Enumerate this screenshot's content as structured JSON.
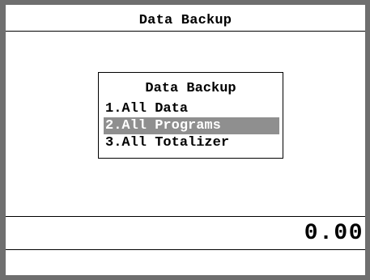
{
  "window": {
    "title": "Data Backup"
  },
  "dialog": {
    "title": "Data Backup",
    "items": [
      {
        "label": "1.All Data",
        "selected": false
      },
      {
        "label": "2.All Programs",
        "selected": true
      },
      {
        "label": "3.All Totalizer",
        "selected": false
      }
    ]
  },
  "footer": {
    "amount": "0.00"
  },
  "colors": {
    "selection": "#8f8f8f",
    "frame": "#6f6f6f",
    "text": "#000000",
    "background": "#ffffff"
  }
}
